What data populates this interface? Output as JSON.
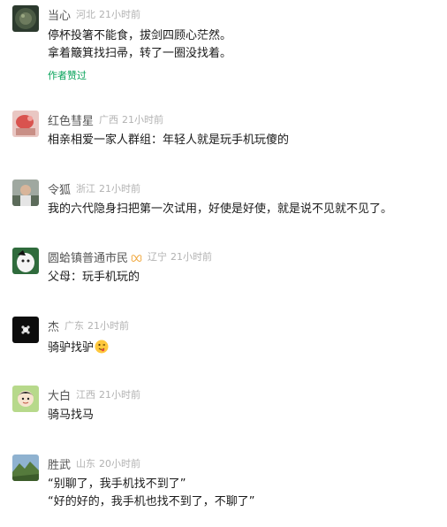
{
  "comments": [
    {
      "name": "当心",
      "location": "河北",
      "time": "21小时前",
      "lines": [
        "停杯投箸不能食，拔剑四顾心茫然。",
        "拿着簸箕找扫帚，转了一圈没找着。"
      ],
      "author_liked": "作者赞过",
      "avatar_icon": "dark-round-avatar-icon"
    },
    {
      "name": "红色彗星",
      "location": "广西",
      "time": "21小时前",
      "lines": [
        "相亲相爱一家人群组：年轻人就是玩手机玩傻的"
      ],
      "avatar_icon": "pink-hand-avatar-icon"
    },
    {
      "name": "令狐",
      "location": "浙江",
      "time": "21小时前",
      "lines": [
        "我的六代隐身扫把第一次试用，好使是好使，就是说不见就不见了。"
      ],
      "avatar_icon": "person-photo-avatar-icon"
    },
    {
      "name": "圆蛤镇普通市民",
      "location": "辽宁",
      "time": "21小时前",
      "lines": [
        "父母：玩手机玩的"
      ],
      "avatar_icon": "cartoon-character-avatar-icon",
      "badge_icon": "butterfly-badge-icon"
    },
    {
      "name": "杰",
      "location": "广东",
      "time": "21小时前",
      "lines": [
        "骑驴找驴"
      ],
      "emoji_icon": "wink-tongue-emoji-icon",
      "avatar_icon": "black-flower-avatar-icon"
    },
    {
      "name": "大白",
      "location": "江西",
      "time": "21小时前",
      "lines": [
        "骑马找马"
      ],
      "avatar_icon": "cartoon-face-avatar-icon"
    },
    {
      "name": "胜武",
      "location": "山东",
      "time": "20小时前",
      "lines": [
        "“别聊了，我手机找不到了”",
        "“好的好的，我手机也找不到了，不聊了”"
      ],
      "avatar_icon": "landscape-avatar-icon"
    }
  ],
  "colors": {
    "name": "#555555",
    "meta": "#b2b2b2",
    "liked": "#07a35a"
  }
}
